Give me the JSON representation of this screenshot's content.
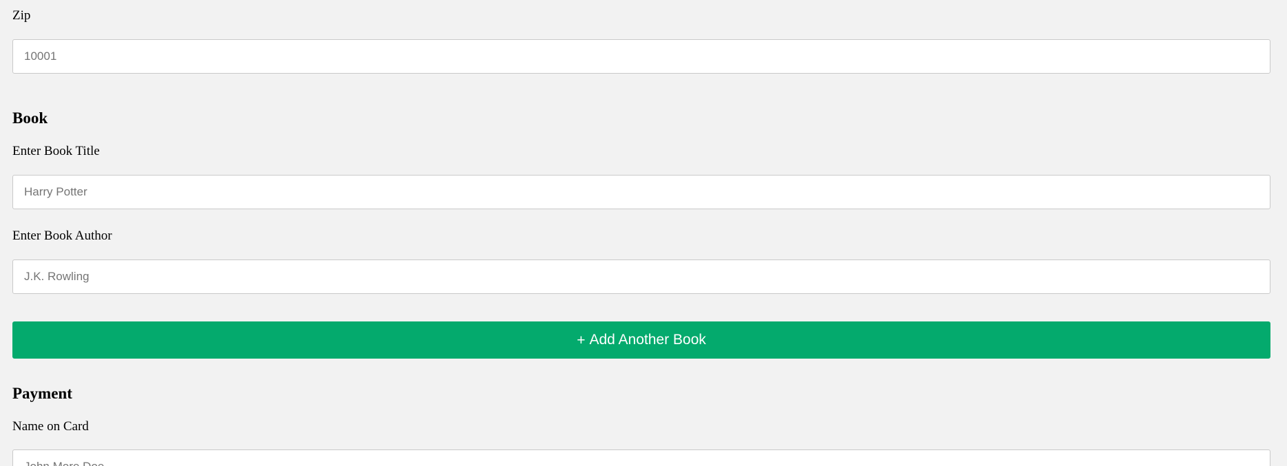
{
  "address": {
    "zip_label": "Zip",
    "zip_placeholder": "10001"
  },
  "book": {
    "section_title": "Book",
    "title_label": "Enter Book Title",
    "title_placeholder": "Harry Potter",
    "author_label": "Enter Book Author",
    "author_placeholder": "J.K. Rowling",
    "add_button_icon": "+",
    "add_button_label": "Add Another Book"
  },
  "payment": {
    "section_title": "Payment",
    "name_label": "Name on Card",
    "name_placeholder": "John More Doe"
  },
  "colors": {
    "background": "#f2f2f2",
    "button_accent": "#04aa6d",
    "input_border": "#c9c9c9"
  }
}
